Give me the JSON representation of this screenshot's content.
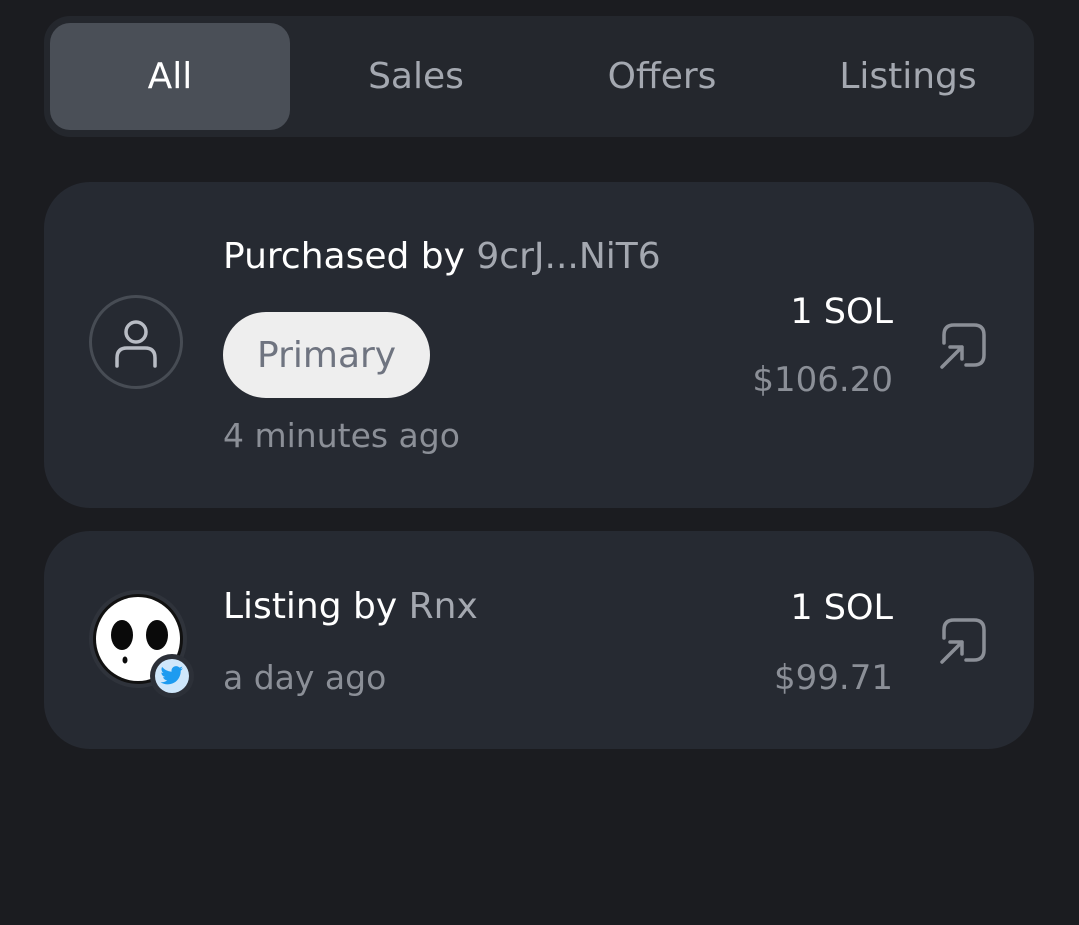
{
  "tabs": [
    {
      "label": "All",
      "active": true
    },
    {
      "label": "Sales",
      "active": false
    },
    {
      "label": "Offers",
      "active": false
    },
    {
      "label": "Listings",
      "active": false
    }
  ],
  "activity": [
    {
      "action": "Purchased by",
      "actor": "9crJ...NiT6",
      "badge": "Primary",
      "time": "4 minutes ago",
      "price": "1 SOL",
      "usd": "$106.20",
      "avatar": "user-icon",
      "link_icon": "external-link-icon"
    },
    {
      "action": "Listing by",
      "actor": "Rnx",
      "time": "a day ago",
      "price": "1 SOL",
      "usd": "$99.71",
      "avatar": "ghost-avatar",
      "social_icon": "twitter-icon",
      "link_icon": "external-link-icon"
    }
  ],
  "colors": {
    "background": "#1b1c20",
    "card": "#262a32",
    "tab_active": "#4a4f57",
    "twitter_blue": "#1d9bf0"
  }
}
